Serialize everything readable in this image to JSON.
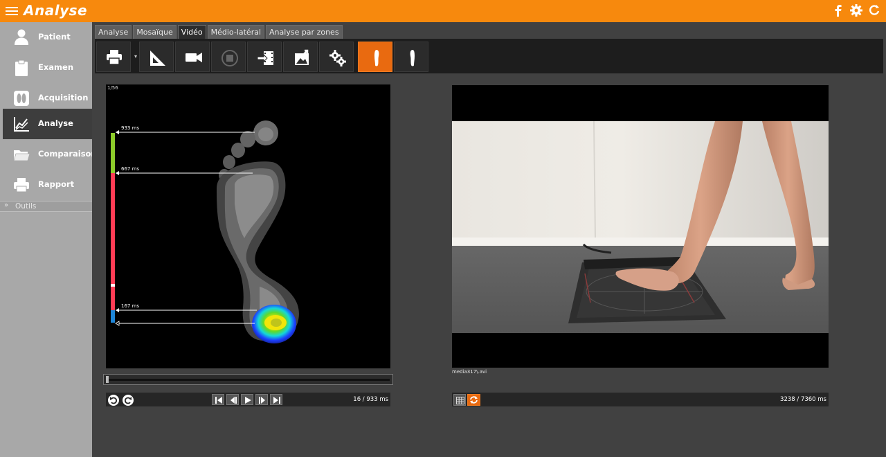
{
  "app": {
    "title": "Analyse"
  },
  "sidebar": {
    "items": [
      {
        "label": "Patient",
        "icon": "person-icon"
      },
      {
        "label": "Examen",
        "icon": "clipboard-icon"
      },
      {
        "label": "Acquisition",
        "icon": "feet-icon"
      },
      {
        "label": "Analyse",
        "icon": "chart-icon"
      },
      {
        "label": "Comparaison",
        "icon": "folder-icon"
      },
      {
        "label": "Rapport",
        "icon": "printer-icon"
      }
    ],
    "active": "Analyse",
    "tools": {
      "label": "Outils",
      "icon": "chevron-double-right-icon"
    }
  },
  "tabs": [
    {
      "label": "Analyse"
    },
    {
      "label": "Mosaïque"
    },
    {
      "label": "Vidéo"
    },
    {
      "label": "Médio-latéral"
    },
    {
      "label": "Analyse par zones"
    }
  ],
  "active_tab": "Vidéo",
  "toolbar": {
    "buttons": [
      "printer-icon",
      "set-square-icon",
      "video-camera-icon",
      "stop-icon",
      "import-video-icon",
      "export-image-icon",
      "settings-icon",
      "foot-right-icon",
      "foot-left-icon"
    ],
    "active": "foot-right-icon"
  },
  "left_viewer": {
    "frame_counter": "1/56",
    "markers": [
      {
        "label": "933 ms"
      },
      {
        "label": "667 ms"
      },
      {
        "label": "167 ms"
      }
    ],
    "time_info": "16 / 933 ms",
    "scrub_position": 0.0
  },
  "right_viewer": {
    "filename": "media317\\.avi",
    "time_info": "3238 / 7360 ms"
  },
  "colors": {
    "accent": "#f7890d",
    "active_button": "#e96a10",
    "timeline_green": "#8dcc2a",
    "timeline_red": "#ff3c55",
    "timeline_blue": "#1e86d8"
  }
}
